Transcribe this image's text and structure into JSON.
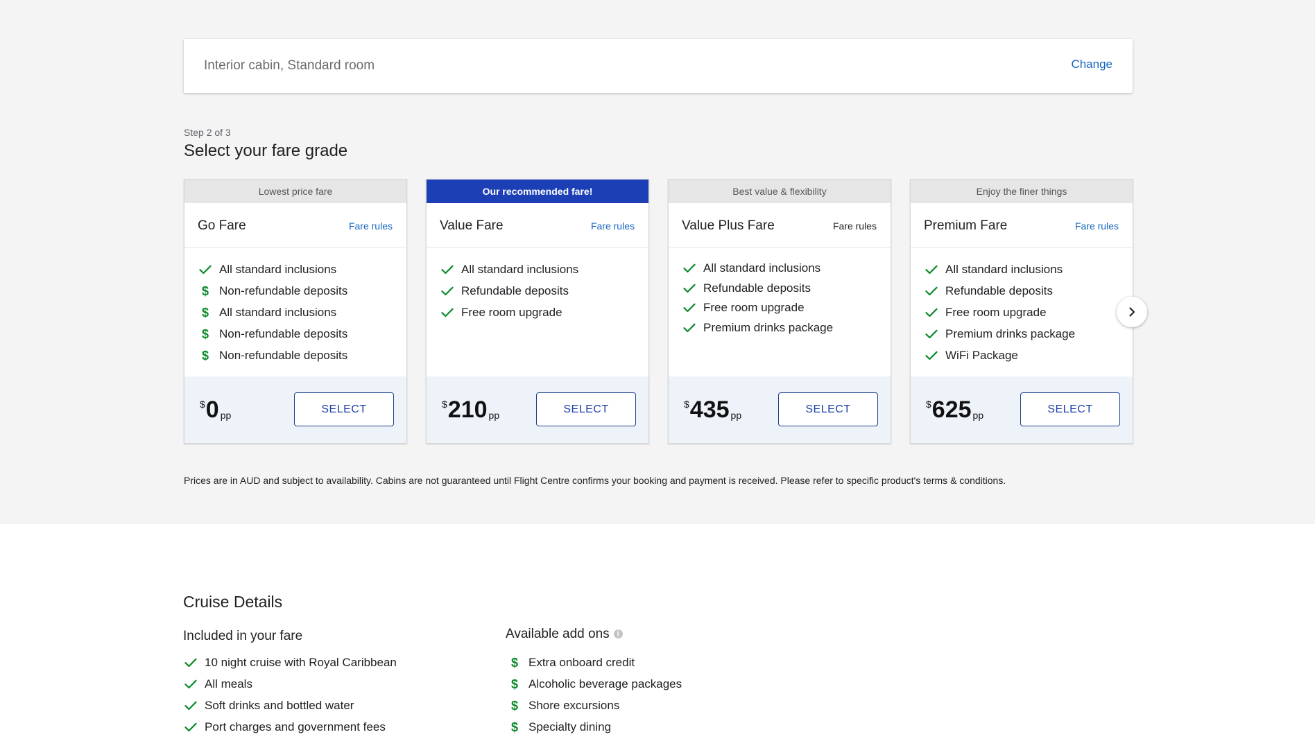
{
  "cabin": {
    "label": "Interior cabin, Standard room",
    "change_label": "Change"
  },
  "step": {
    "label": "Step 2 of 3",
    "title": "Select your fare grade"
  },
  "fares": [
    {
      "banner": "Lowest price fare",
      "name": "Go Fare",
      "rules_label": "Fare rules",
      "features": [
        {
          "text": "All standard inclusions",
          "icon": "check-icon"
        },
        {
          "text": "Non-refundable deposits",
          "icon": "dollar-icon"
        },
        {
          "text": "All standard inclusions",
          "icon": "dollar-icon"
        },
        {
          "text": "Non-refundable deposits",
          "icon": "dollar-icon"
        },
        {
          "text": "Non-refundable deposits",
          "icon": "dollar-icon"
        }
      ],
      "currency": "$",
      "price": "0",
      "unit": "pp",
      "select_label": "SELECT"
    },
    {
      "banner": "Our recommended fare!",
      "name": "Value Fare",
      "rules_label": "Fare rules",
      "features": [
        {
          "text": "All standard inclusions",
          "icon": "check-icon"
        },
        {
          "text": "Refundable deposits",
          "icon": "check-icon"
        },
        {
          "text": "Free room upgrade",
          "icon": "check-icon"
        }
      ],
      "currency": "$",
      "price": "210",
      "unit": "pp",
      "select_label": "SELECT"
    },
    {
      "banner": "Best value & flexibility",
      "name": "Value Plus Fare",
      "rules_label": "Fare rules",
      "features": [
        {
          "text": "All standard inclusions",
          "icon": "check-icon"
        },
        {
          "text": "Refundable deposits",
          "icon": "check-icon"
        },
        {
          "text": "Free room upgrade",
          "icon": "check-icon"
        },
        {
          "text": "Premium drinks package",
          "icon": "check-icon"
        }
      ],
      "currency": "$",
      "price": "435",
      "unit": "pp",
      "select_label": "SELECT"
    },
    {
      "banner": "Enjoy the finer things",
      "name": "Premium Fare",
      "rules_label": "Fare rules",
      "features": [
        {
          "text": "All standard inclusions",
          "icon": "check-icon"
        },
        {
          "text": "Refundable deposits",
          "icon": "check-icon"
        },
        {
          "text": "Free room upgrade",
          "icon": "check-icon"
        },
        {
          "text": "Premium drinks package",
          "icon": "check-icon"
        },
        {
          "text": "WiFi Package",
          "icon": "check-icon"
        }
      ],
      "currency": "$",
      "price": "625",
      "unit": "pp",
      "select_label": "SELECT"
    }
  ],
  "disclaimer": "Prices are in AUD and subject to availability. Cabins are not guaranteed until Flight Centre confirms your booking and payment is received. Please refer to specific product's terms & conditions.",
  "cruise_details": {
    "title": "Cruise Details",
    "included": {
      "title": "Included in your fare",
      "items": [
        "10 night cruise with Royal Caribbean",
        "All meals",
        "Soft drinks and bottled water",
        "Port charges and government fees"
      ]
    },
    "addons": {
      "title": "Available add ons",
      "items": [
        "Extra onboard credit",
        "Alcoholic beverage packages",
        "Shore excursions",
        "Specialty dining"
      ]
    }
  },
  "colors": {
    "accent_blue": "#1565c0",
    "recommended_banner": "#1c3fb5",
    "success_green": "#0a8a2a",
    "price_panel": "#eef3fa"
  }
}
